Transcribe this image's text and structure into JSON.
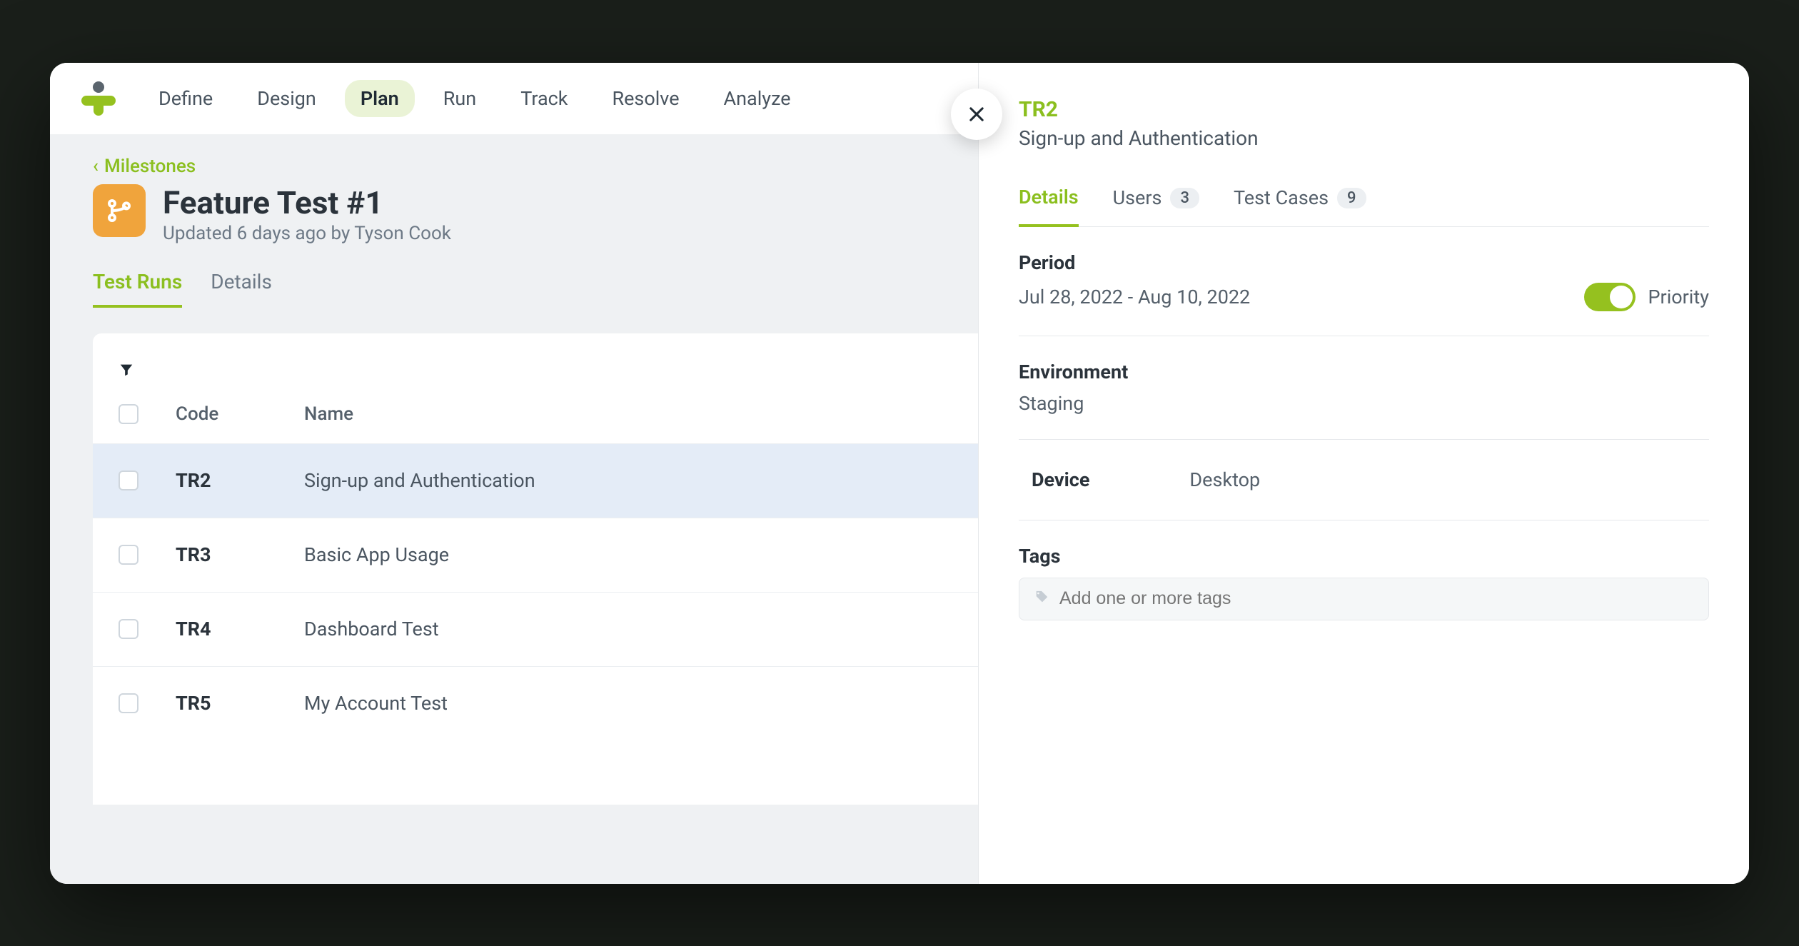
{
  "nav": {
    "items": [
      "Define",
      "Design",
      "Plan",
      "Run",
      "Track",
      "Resolve",
      "Analyze"
    ],
    "active": "Plan"
  },
  "breadcrumb": {
    "back": "Milestones"
  },
  "page": {
    "title": "Feature Test #1",
    "subtitle": "Updated 6 days ago by Tyson Cook"
  },
  "left_tabs": {
    "items": [
      "Test Runs",
      "Details"
    ],
    "active": "Test Runs"
  },
  "table": {
    "headers": {
      "code": "Code",
      "name": "Name"
    },
    "rows": [
      {
        "code": "TR2",
        "name": "Sign-up and Authentication",
        "selected": true
      },
      {
        "code": "TR3",
        "name": "Basic App Usage",
        "selected": false
      },
      {
        "code": "TR4",
        "name": "Dashboard Test",
        "selected": false
      },
      {
        "code": "TR5",
        "name": "My Account Test",
        "selected": false
      }
    ]
  },
  "detail": {
    "id": "TR2",
    "name": "Sign-up and Authentication",
    "tabs": [
      {
        "label": "Details",
        "count": null,
        "active": true
      },
      {
        "label": "Users",
        "count": "3",
        "active": false
      },
      {
        "label": "Test Cases",
        "count": "9",
        "active": false
      }
    ],
    "period": {
      "label": "Period",
      "value": "Jul 28, 2022 - Aug 10, 2022"
    },
    "priority_label": "Priority",
    "environment": {
      "label": "Environment",
      "value": "Staging"
    },
    "device": {
      "label": "Device",
      "value": "Desktop"
    },
    "tags": {
      "label": "Tags",
      "placeholder": "Add one or more tags"
    }
  }
}
